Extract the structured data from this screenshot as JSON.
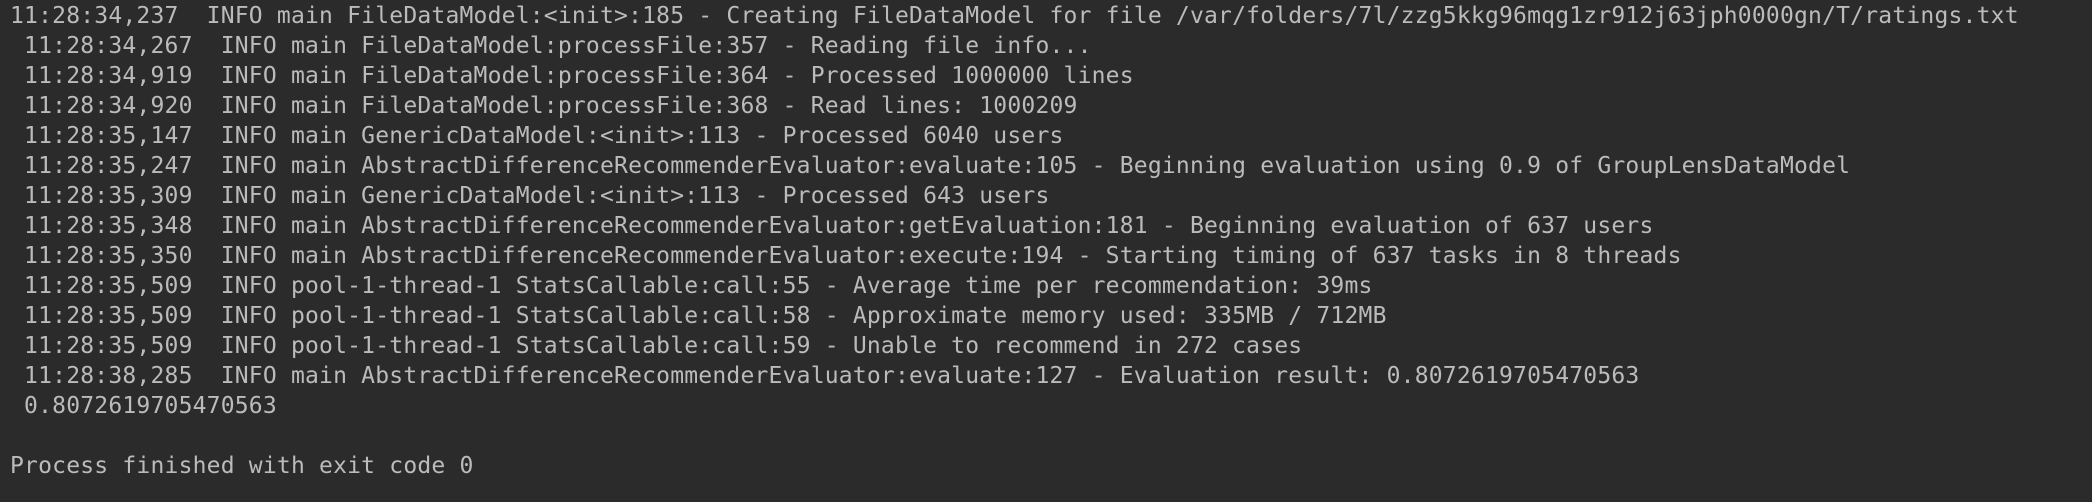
{
  "console": {
    "lines": [
      "11:28:34,237  INFO main FileDataModel:<init>:185 - Creating FileDataModel for file /var/folders/7l/zzg5kkg96mqg1zr912j63jph0000gn/T/ratings.txt",
      " 11:28:34,267  INFO main FileDataModel:processFile:357 - Reading file info...",
      " 11:28:34,919  INFO main FileDataModel:processFile:364 - Processed 1000000 lines",
      " 11:28:34,920  INFO main FileDataModel:processFile:368 - Read lines: 1000209",
      " 11:28:35,147  INFO main GenericDataModel:<init>:113 - Processed 6040 users",
      " 11:28:35,247  INFO main AbstractDifferenceRecommenderEvaluator:evaluate:105 - Beginning evaluation using 0.9 of GroupLensDataModel",
      " 11:28:35,309  INFO main GenericDataModel:<init>:113 - Processed 643 users",
      " 11:28:35,348  INFO main AbstractDifferenceRecommenderEvaluator:getEvaluation:181 - Beginning evaluation of 637 users",
      " 11:28:35,350  INFO main AbstractDifferenceRecommenderEvaluator:execute:194 - Starting timing of 637 tasks in 8 threads",
      " 11:28:35,509  INFO pool-1-thread-1 StatsCallable:call:55 - Average time per recommendation: 39ms",
      " 11:28:35,509  INFO pool-1-thread-1 StatsCallable:call:58 - Approximate memory used: 335MB / 712MB",
      " 11:28:35,509  INFO pool-1-thread-1 StatsCallable:call:59 - Unable to recommend in 272 cases",
      " 11:28:38,285  INFO main AbstractDifferenceRecommenderEvaluator:evaluate:127 - Evaluation result: 0.8072619705470563",
      " 0.8072619705470563"
    ],
    "exit_message": "Process finished with exit code 0"
  },
  "colors": {
    "background": "#2b2b2b",
    "text": "#bbbbbb"
  }
}
